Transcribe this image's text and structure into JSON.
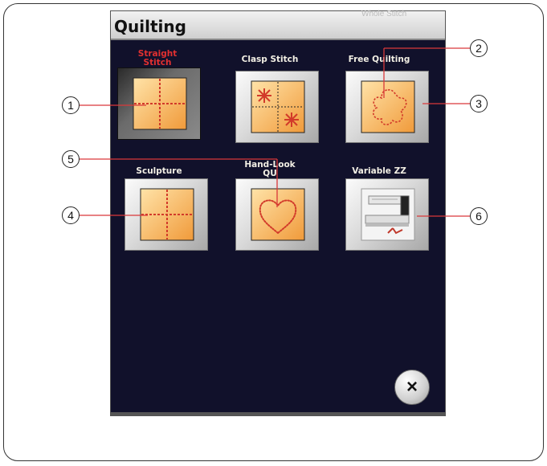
{
  "screen": {
    "title": "Quilting",
    "faint_text": "Whole Stitch"
  },
  "buttons": [
    {
      "id": "straight",
      "label": "Straight\nStitch",
      "selected": true
    },
    {
      "id": "clasp",
      "label": "Clasp Stitch",
      "selected": false
    },
    {
      "id": "free",
      "label": "Free Quilting",
      "selected": false
    },
    {
      "id": "sculpture",
      "label": "Sculpture",
      "selected": false
    },
    {
      "id": "handlook",
      "label": "Hand-Look\nQU",
      "selected": false
    },
    {
      "id": "variable",
      "label": "Variable ZZ",
      "selected": false
    }
  ],
  "close_icon": "×",
  "callouts": [
    "1",
    "2",
    "3",
    "4",
    "5",
    "6"
  ],
  "colors": {
    "accent_selected": "#e23030",
    "stitch": "#d23a2a",
    "pad": "#f4a640"
  }
}
